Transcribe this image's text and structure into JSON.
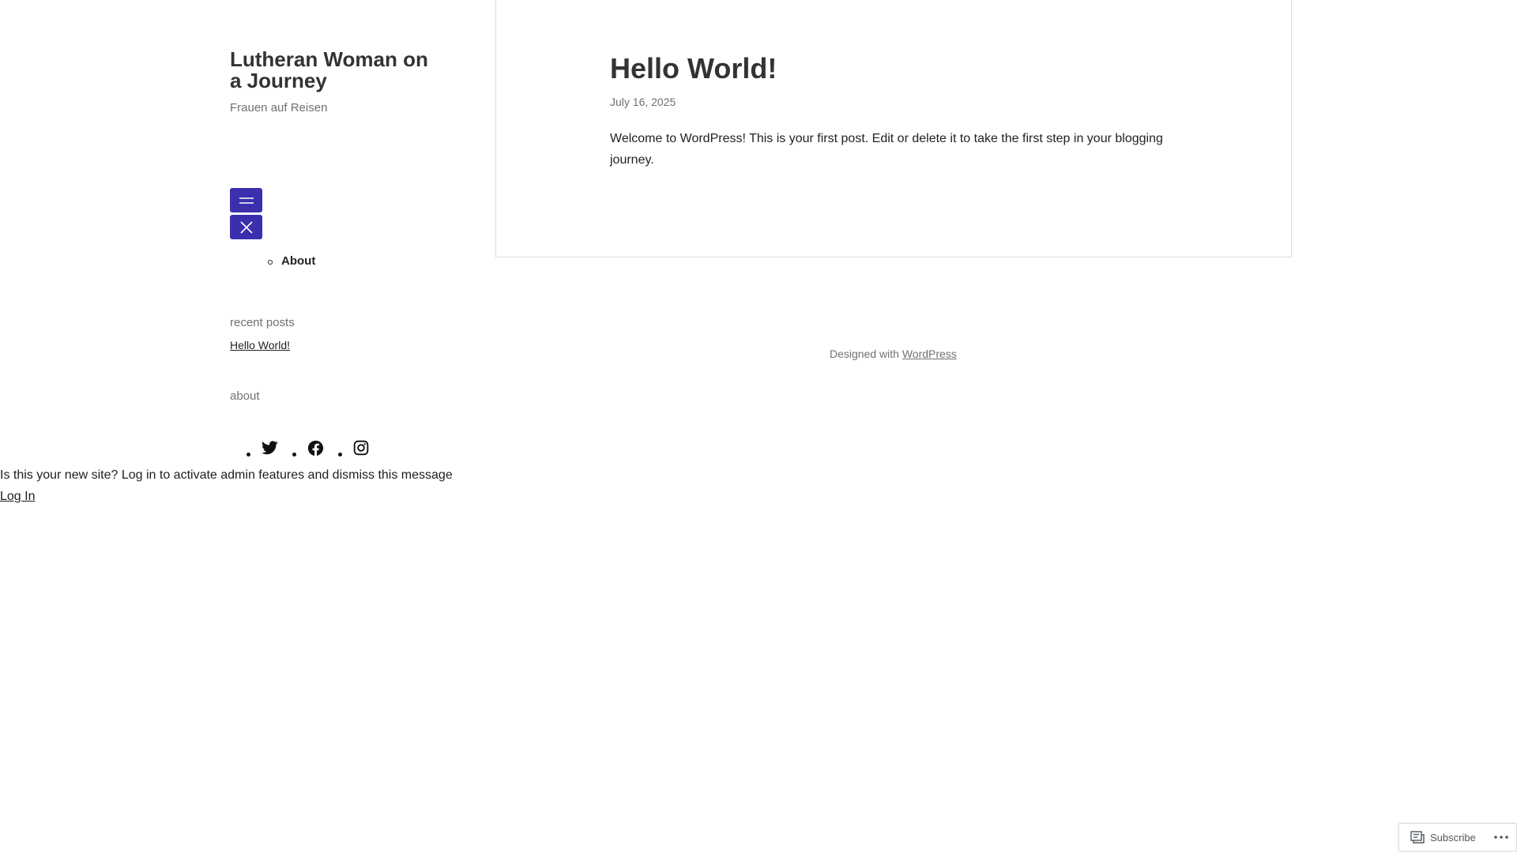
{
  "site": {
    "title": "Lutheran Woman on a Journey",
    "tagline": "Frauen auf Reisen"
  },
  "menu": {
    "open_icon": "hamburger-icon",
    "close_icon": "close-icon",
    "items": [
      {
        "label": "About"
      }
    ]
  },
  "widgets": {
    "recent_posts_title": "recent posts",
    "recent_posts": [
      {
        "label": "Hello World!"
      }
    ],
    "about_title": "about",
    "social_icons": [
      "twitter-icon",
      "facebook-icon",
      "instagram-icon"
    ]
  },
  "notice": {
    "message": "Is this your new site? Log in to activate admin features and dismiss this message",
    "login_label": "Log In"
  },
  "post": {
    "title": "Hello World!",
    "date": "July 16, 2025",
    "body": "Welcome to WordPress! This is your first post. Edit or delete it to take the first step in your blogging journey."
  },
  "footer": {
    "credit_prefix": "Designed with",
    "credit_link": "WordPress"
  },
  "subscribe_bar": {
    "subscribe_label": "Subscribe",
    "subscribe_icon": "reader-icon",
    "more_icon": "ellipsis-icon"
  },
  "colors": {
    "menu_button": "#3c2fad",
    "text": "#1e1e1e",
    "muted": "#707070"
  }
}
